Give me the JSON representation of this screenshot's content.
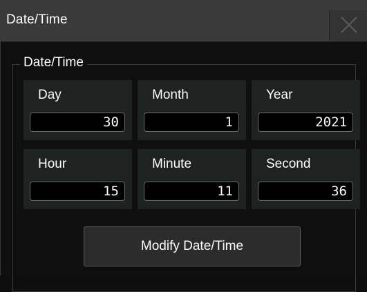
{
  "window": {
    "title": "Date/Time"
  },
  "group": {
    "label": "Date/Time"
  },
  "fields": {
    "day": {
      "label": "Day",
      "value": "30"
    },
    "month": {
      "label": "Month",
      "value": "1"
    },
    "year": {
      "label": "Year",
      "value": "2021"
    },
    "hour": {
      "label": "Hour",
      "value": "15"
    },
    "minute": {
      "label": "Minute",
      "value": "11"
    },
    "second": {
      "label": "Second",
      "value": "36"
    }
  },
  "actions": {
    "modify_label": "Modify Date/Time"
  },
  "icons": {
    "close": "close-icon"
  },
  "colors": {
    "background": "#0f0f0f",
    "titlebar": "#3a3a3a",
    "cell": "#1e2221",
    "input_bg": "#000000"
  }
}
